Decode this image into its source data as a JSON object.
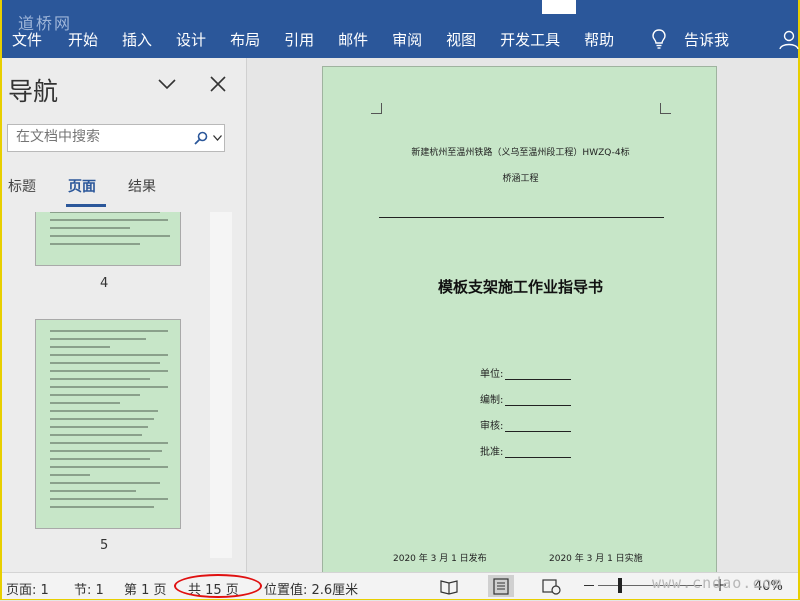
{
  "watermark_top": "道桥网",
  "watermark_bottom": "www.cndao.com",
  "ribbon": {
    "tabs": [
      "文件",
      "开始",
      "插入",
      "设计",
      "布局",
      "引用",
      "邮件",
      "审阅",
      "视图",
      "开发工具",
      "帮助"
    ],
    "tell_me": "告诉我"
  },
  "nav": {
    "title": "导航",
    "search_placeholder": "在文档中搜索",
    "tabs": [
      "标题",
      "页面",
      "结果"
    ],
    "active_tab": "页面",
    "pages": [
      "4",
      "5"
    ]
  },
  "document": {
    "header_line1": "新建杭州至温州铁路（义乌至温州段工程）HWZQ-4标",
    "header_line2": "桥涵工程",
    "title": "模板支架施工作业指导书",
    "fields": [
      "单位:",
      "编制:",
      "审核:",
      "批准:"
    ],
    "date_issue": "2020 年 3 月 1 日发布",
    "date_effective": "2020 年 3 月 1 日实施"
  },
  "status_bar": {
    "page": "页面: 1",
    "section": "节: 1",
    "page_of": "第 1 页",
    "total": "共 15 页",
    "position": "位置值: 2.6厘米",
    "zoom": "40%",
    "zoom_level": 0.4
  },
  "colors": {
    "ribbon": "#2b579a",
    "page_background": "#c7e6c8",
    "highlight_circle": "#e01010",
    "border": "#e8cf00"
  }
}
